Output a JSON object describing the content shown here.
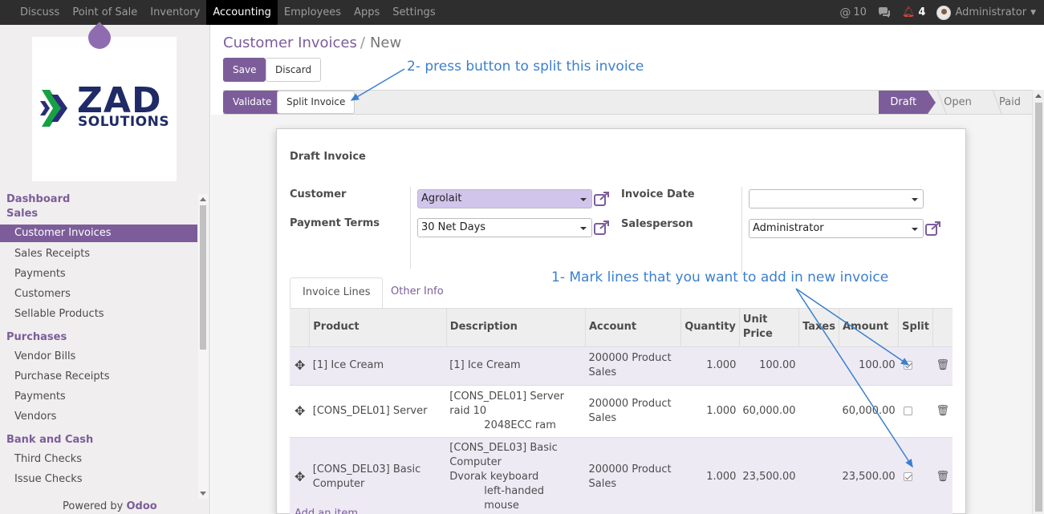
{
  "topbar": {
    "menus": [
      "Discuss",
      "Point of Sale",
      "Inventory",
      "Accounting",
      "Employees",
      "Apps",
      "Settings"
    ],
    "active_menu": "Accounting",
    "mentions_count": "10",
    "notifications_count": "4",
    "user": "Administrator"
  },
  "brand": {
    "logo_main": "ZAD",
    "logo_sub": "SOLUTIONS"
  },
  "sidebar": {
    "sections": [
      {
        "title": "Dashboard",
        "items": []
      },
      {
        "title": "Sales",
        "items": [
          "Customer Invoices",
          "Sales Receipts",
          "Payments",
          "Customers",
          "Sellable Products"
        ]
      },
      {
        "title": "Purchases",
        "items": [
          "Vendor Bills",
          "Purchase Receipts",
          "Payments",
          "Vendors"
        ]
      },
      {
        "title": "Bank and Cash",
        "items": [
          "Third Checks",
          "Issue Checks"
        ]
      }
    ],
    "active_item": "Customer Invoices",
    "powered_by": "Powered by",
    "powered_brand": "Odoo"
  },
  "breadcrumb": {
    "parent": "Customer Invoices",
    "separator": "/",
    "current": "New"
  },
  "buttons": {
    "save": "Save",
    "discard": "Discard",
    "validate": "Validate",
    "split": "Split Invoice"
  },
  "stages": [
    "Draft",
    "Open",
    "Paid"
  ],
  "active_stage": "Draft",
  "form": {
    "heading": "Draft Invoice",
    "customer_label": "Customer",
    "customer_value": "Agrolait",
    "payment_terms_label": "Payment Terms",
    "payment_terms_value": "30 Net Days",
    "invoice_date_label": "Invoice Date",
    "invoice_date_value": "",
    "salesperson_label": "Salesperson",
    "salesperson_value": "Administrator"
  },
  "tabs": [
    "Invoice Lines",
    "Other Info"
  ],
  "table": {
    "headers": [
      "Product",
      "Description",
      "Account",
      "Quantity",
      "Unit Price",
      "Taxes",
      "Amount",
      "Split"
    ],
    "rows": [
      {
        "product": "[1] Ice Cream",
        "description": [
          "[1] Ice Cream"
        ],
        "account": [
          "200000 Product",
          "Sales"
        ],
        "quantity": "1.000",
        "unit_price": "100.00",
        "taxes": "",
        "amount": "100.00",
        "split": true
      },
      {
        "product": "[CONS_DEL01] Server",
        "description": [
          "[CONS_DEL01] Server",
          "raid 10",
          "2048ECC ram"
        ],
        "account": [
          "200000 Product",
          "Sales"
        ],
        "quantity": "1.000",
        "unit_price": "60,000.00",
        "taxes": "",
        "amount": "60,000.00",
        "split": false
      },
      {
        "product": "[CONS_DEL03] Basic Computer",
        "description": [
          "[CONS_DEL03] Basic",
          "Computer",
          "Dvorak keyboard",
          "left-handed mouse"
        ],
        "account": [
          "200000 Product",
          "Sales"
        ],
        "quantity": "1.000",
        "unit_price": "23,500.00",
        "taxes": "",
        "amount": "23,500.00",
        "split": true
      }
    ],
    "add_item": "Add an item"
  },
  "annotations": {
    "step1": "1- Mark lines that you want to add in new  invoice",
    "step2": "2- press button to split this invoice"
  },
  "colors": {
    "primary": "#7c5d9a",
    "annotation": "#3b7fd0",
    "navbar": "#2e2e2e"
  }
}
